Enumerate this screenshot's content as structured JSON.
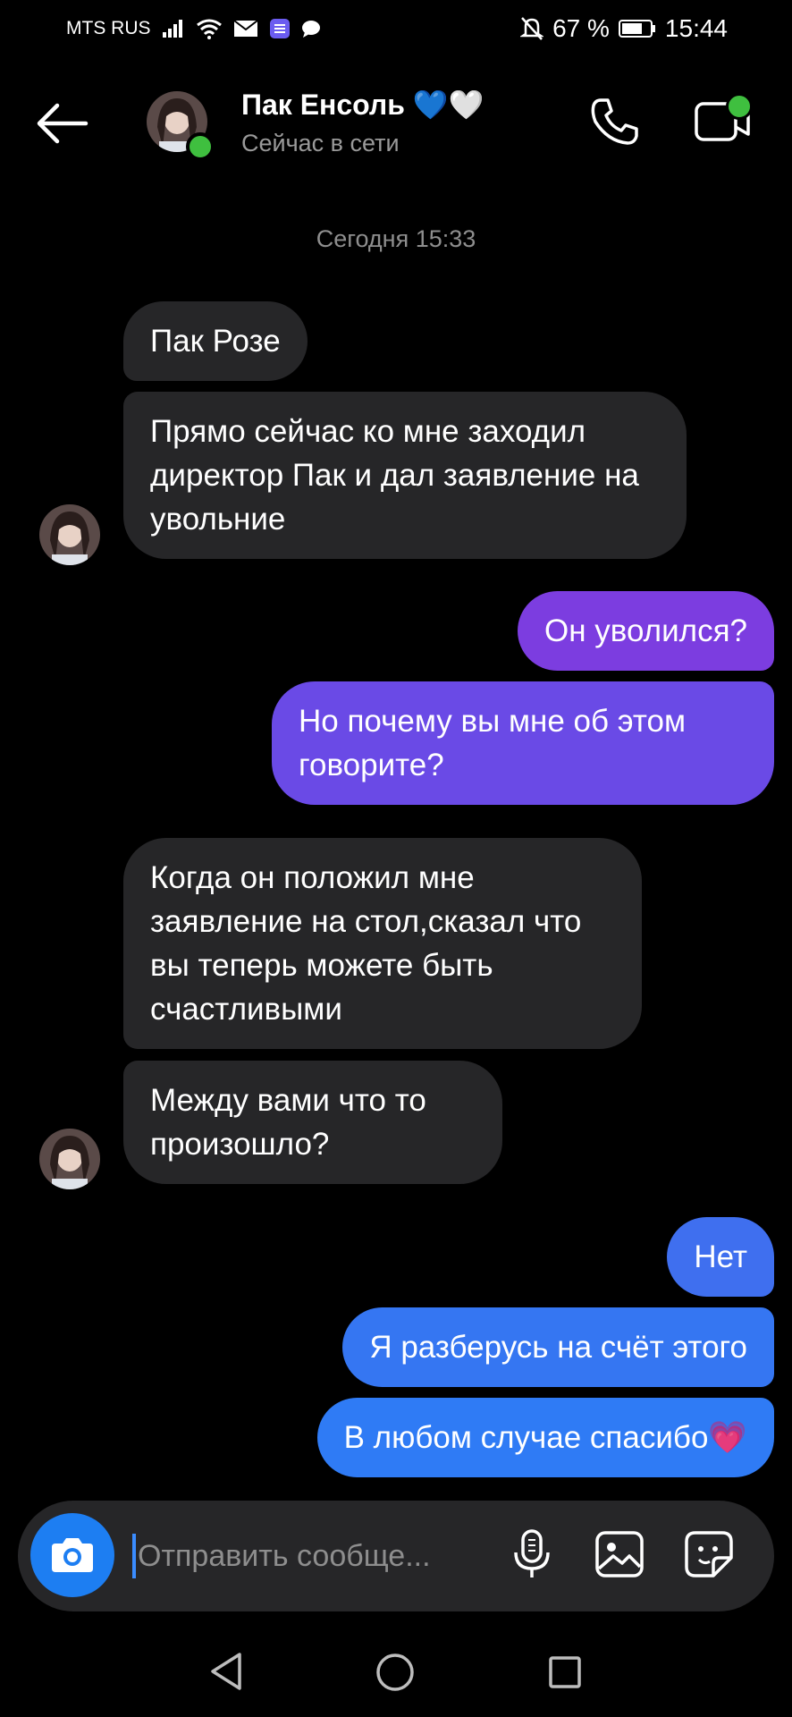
{
  "status_bar": {
    "carrier": "MTS RUS",
    "battery": "67 %",
    "time": "15:44"
  },
  "header": {
    "contact_name": "Пак Енсоль 💙🤍",
    "contact_status": "Сейчас в сети"
  },
  "date_separator": "Сегодня 15:33",
  "messages": [
    {
      "dir": "in",
      "text": "Пак Розе"
    },
    {
      "dir": "in",
      "text": "Прямо сейчас ко мне заходил директор Пак и дал заявление на увольние"
    },
    {
      "dir": "out",
      "text": "Он уволился?"
    },
    {
      "dir": "out",
      "text": "Но почему вы мне об этом говорите?"
    },
    {
      "dir": "in",
      "text": "Когда он положил мне заявление на стол,сказал что вы теперь можете быть счастливыми"
    },
    {
      "dir": "in",
      "text": "Между вами что то произошло?"
    },
    {
      "dir": "out",
      "text": "Нет"
    },
    {
      "dir": "out",
      "text": "Я разберусь на счёт этого"
    },
    {
      "dir": "out",
      "text": "В любом случае спасибо💗"
    }
  ],
  "composer": {
    "placeholder": "Отправить сообще..."
  },
  "colors": {
    "incoming": "#262628",
    "outgoing_top": "#7a3ce0",
    "outgoing_bottom": "#2f7bf5",
    "online": "#3fbf3f",
    "camera": "#1d7ef2"
  },
  "icons": [
    "back-arrow-icon",
    "phone-icon",
    "video-camera-icon",
    "camera-icon",
    "microphone-icon",
    "gallery-icon",
    "sticker-icon",
    "nav-back-icon",
    "nav-home-icon",
    "nav-recent-icon"
  ]
}
